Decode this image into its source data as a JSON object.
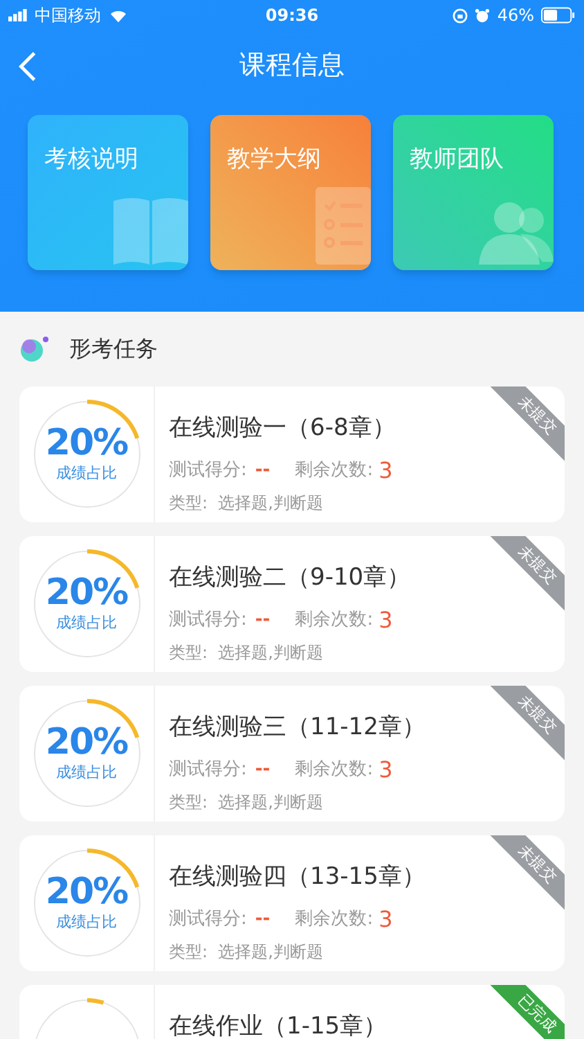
{
  "status_bar": {
    "carrier": "中国移动",
    "time": "09:36",
    "battery": "46%"
  },
  "nav": {
    "title": "课程信息"
  },
  "tiles": [
    {
      "label": "考核说明",
      "kind": "book"
    },
    {
      "label": "教学大纲",
      "kind": "syllabus"
    },
    {
      "label": "教师团队",
      "kind": "team"
    }
  ],
  "section": {
    "title": "形考任务"
  },
  "tasks": [
    {
      "percent": "20%",
      "percent_label": "成绩占比",
      "level": 0.2,
      "title": "在线测验一（6-8章）",
      "score_label": "测试得分:",
      "score": "--",
      "remaining_label": "剩余次数:",
      "remaining": "3",
      "type": "类型:  选择题,判断题",
      "status": "未提交",
      "done": false
    },
    {
      "percent": "20%",
      "percent_label": "成绩占比",
      "level": 0.2,
      "title": "在线测验二（9-10章）",
      "score_label": "测试得分:",
      "score": "--",
      "remaining_label": "剩余次数:",
      "remaining": "3",
      "type": "类型:  选择题,判断题",
      "status": "未提交",
      "done": false
    },
    {
      "percent": "20%",
      "percent_label": "成绩占比",
      "level": 0.2,
      "title": "在线测验三（11-12章）",
      "score_label": "测试得分:",
      "score": "--",
      "remaining_label": "剩余次数:",
      "remaining": "3",
      "type": "类型:  选择题,判断题",
      "status": "未提交",
      "done": false
    },
    {
      "percent": "20%",
      "percent_label": "成绩占比",
      "level": 0.2,
      "title": "在线测验四（13-15章）",
      "score_label": "测试得分:",
      "score": "--",
      "remaining_label": "剩余次数:",
      "remaining": "3",
      "type": "类型:  选择题,判断题",
      "status": "未提交",
      "done": false
    },
    {
      "level": 0.05,
      "title": "在线作业（1-15章）",
      "status": "已完成",
      "done": true
    }
  ]
}
